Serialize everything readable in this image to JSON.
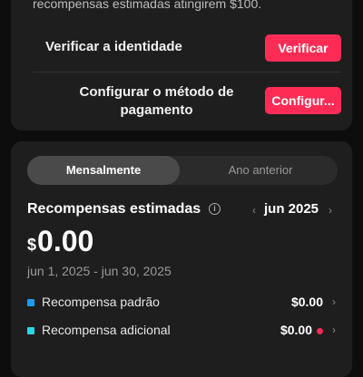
{
  "notice_text": "recompensas estimadas atingirem $100.",
  "verify": {
    "label": "Verificar a identidade",
    "button": "Verificar"
  },
  "payment": {
    "label": "Configurar o método de pagamento",
    "button": "Configur..."
  },
  "period_tabs": {
    "monthly": "Mensalmente",
    "previous_year": "Ano anterior"
  },
  "rewards": {
    "title": "Recompensas estimadas",
    "month": "jun 2025",
    "currency": "$",
    "amount": "0.00",
    "range": "jun 1, 2025 - jun 30, 2025",
    "items": [
      {
        "label": "Recompensa padrão",
        "value": "$0.00",
        "color": "#1d9bf0"
      },
      {
        "label": "Recompensa adicional",
        "value": "$0.00",
        "color": "#25d8e6",
        "alert_dot_color": "#fe2c55"
      }
    ]
  },
  "icons": {
    "info": "info-icon",
    "prev": "chevron-left-icon",
    "next": "chevron-right-icon",
    "row": "chevron-right-icon"
  },
  "colors": {
    "accent": "#fe2c55",
    "card_bg": "#1e1e1e",
    "page_bg": "#0d0d0d"
  }
}
